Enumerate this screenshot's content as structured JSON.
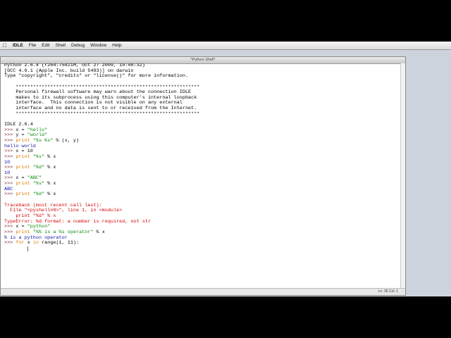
{
  "menubar": {
    "app": "IDLE",
    "items": [
      "File",
      "Edit",
      "Shell",
      "Debug",
      "Window",
      "Help"
    ]
  },
  "window": {
    "title": "*Python Shell*",
    "status": "Ln: 35 Col: 1"
  },
  "shell_lines": [
    {
      "segments": [
        {
          "t": "Python 2.6.4 (r264:75821M, Oct 27 2009, 19:48:32)",
          "c": "plain"
        }
      ]
    },
    {
      "segments": [
        {
          "t": "[GCC 4.0.1 (Apple Inc. build 5493)] on darwin",
          "c": "plain"
        }
      ]
    },
    {
      "segments": [
        {
          "t": "Type \"copyright\", \"credits\" or \"license()\" for more information.",
          "c": "plain"
        }
      ]
    },
    {
      "segments": []
    },
    {
      "segments": [
        {
          "t": "    ****************************************************************",
          "c": "plain"
        }
      ]
    },
    {
      "segments": [
        {
          "t": "    Personal firewall software may warn about the connection IDLE",
          "c": "plain"
        }
      ]
    },
    {
      "segments": [
        {
          "t": "    makes to its subprocess using this computer's internal loopback",
          "c": "plain"
        }
      ]
    },
    {
      "segments": [
        {
          "t": "    interface.  This connection is not visible on any external",
          "c": "plain"
        }
      ]
    },
    {
      "segments": [
        {
          "t": "    interface and no data is sent to or received from the Internet.",
          "c": "plain"
        }
      ]
    },
    {
      "segments": [
        {
          "t": "    ****************************************************************",
          "c": "plain"
        }
      ]
    },
    {
      "segments": []
    },
    {
      "segments": [
        {
          "t": "IDLE 2.6.4",
          "c": "plain"
        }
      ]
    },
    {
      "segments": [
        {
          "t": ">>> ",
          "c": "prompt"
        },
        {
          "t": "x = ",
          "c": "plain"
        },
        {
          "t": "\"hello\"",
          "c": "str"
        }
      ]
    },
    {
      "segments": [
        {
          "t": ">>> ",
          "c": "prompt"
        },
        {
          "t": "y = ",
          "c": "plain"
        },
        {
          "t": "\"world\"",
          "c": "str"
        }
      ]
    },
    {
      "segments": [
        {
          "t": ">>> ",
          "c": "prompt"
        },
        {
          "t": "print ",
          "c": "kw"
        },
        {
          "t": "\"%s %s\"",
          "c": "str"
        },
        {
          "t": " % (x, y)",
          "c": "plain"
        }
      ]
    },
    {
      "segments": [
        {
          "t": "hello world",
          "c": "out"
        }
      ]
    },
    {
      "segments": [
        {
          "t": ">>> ",
          "c": "prompt"
        },
        {
          "t": "x = 10",
          "c": "plain"
        }
      ]
    },
    {
      "segments": [
        {
          "t": ">>> ",
          "c": "prompt"
        },
        {
          "t": "print ",
          "c": "kw"
        },
        {
          "t": "\"%s\"",
          "c": "str"
        },
        {
          "t": " % x",
          "c": "plain"
        }
      ]
    },
    {
      "segments": [
        {
          "t": "10",
          "c": "out"
        }
      ]
    },
    {
      "segments": [
        {
          "t": ">>> ",
          "c": "prompt"
        },
        {
          "t": "print ",
          "c": "kw"
        },
        {
          "t": "\"%d\"",
          "c": "str"
        },
        {
          "t": " % x",
          "c": "plain"
        }
      ]
    },
    {
      "segments": [
        {
          "t": "10",
          "c": "out"
        }
      ]
    },
    {
      "segments": [
        {
          "t": ">>> ",
          "c": "prompt"
        },
        {
          "t": "x = ",
          "c": "plain"
        },
        {
          "t": "\"ABC\"",
          "c": "str"
        }
      ]
    },
    {
      "segments": [
        {
          "t": ">>> ",
          "c": "prompt"
        },
        {
          "t": "print ",
          "c": "kw"
        },
        {
          "t": "\"%s\"",
          "c": "str"
        },
        {
          "t": " % x",
          "c": "plain"
        }
      ]
    },
    {
      "segments": [
        {
          "t": "ABC",
          "c": "out"
        }
      ]
    },
    {
      "segments": [
        {
          "t": ">>> ",
          "c": "prompt"
        },
        {
          "t": "print ",
          "c": "kw"
        },
        {
          "t": "\"%d\"",
          "c": "str"
        },
        {
          "t": " % x",
          "c": "plain"
        }
      ]
    },
    {
      "segments": []
    },
    {
      "segments": [
        {
          "t": "Traceback (most recent call last):",
          "c": "err"
        }
      ]
    },
    {
      "segments": [
        {
          "t": "  File \"<pyshell#8>\", line 1, in <module>",
          "c": "err"
        }
      ]
    },
    {
      "segments": [
        {
          "t": "    print \"%d\" % x",
          "c": "err"
        }
      ]
    },
    {
      "segments": [
        {
          "t": "TypeError: %d format: a number is required, not str",
          "c": "err"
        }
      ]
    },
    {
      "segments": [
        {
          "t": ">>> ",
          "c": "prompt"
        },
        {
          "t": "x = ",
          "c": "plain"
        },
        {
          "t": "\"python\"",
          "c": "str"
        }
      ]
    },
    {
      "segments": [
        {
          "t": ">>> ",
          "c": "prompt"
        },
        {
          "t": "print ",
          "c": "kw"
        },
        {
          "t": "\"%% is a %s operator\"",
          "c": "str"
        },
        {
          "t": " % x",
          "c": "plain"
        }
      ]
    },
    {
      "segments": [
        {
          "t": "% is a python operator",
          "c": "out"
        }
      ]
    },
    {
      "segments": [
        {
          "t": ">>> ",
          "c": "prompt"
        },
        {
          "t": "for ",
          "c": "kw"
        },
        {
          "t": "x ",
          "c": "plain"
        },
        {
          "t": "in ",
          "c": "kw"
        },
        {
          "t": "range(1, 11):",
          "c": "plain"
        }
      ]
    },
    {
      "segments": [
        {
          "t": "        ",
          "c": "plain"
        }
      ],
      "cursor": true
    }
  ]
}
